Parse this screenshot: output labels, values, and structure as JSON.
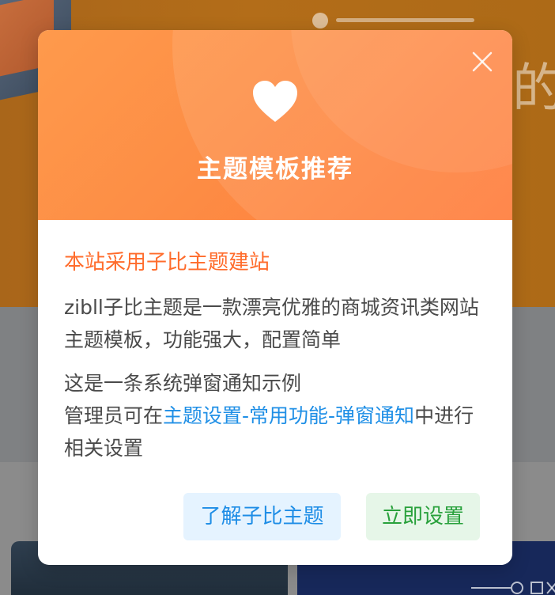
{
  "background": {
    "hero_char": "的"
  },
  "modal": {
    "icon": "heart-icon",
    "close_icon": "close-icon",
    "title": "主题模板推荐",
    "subtitle": "本站采用子比主题建站",
    "description": "zibll子比主题是一款漂亮优雅的商城资讯类网站主题模板，功能强大，配置简单",
    "notice_line1": "这是一条系统弹窗通知示例",
    "notice_prefix": "管理员可在",
    "notice_link": "主题设置-常用功能-弹窗通知",
    "notice_suffix": "中进行相关设置",
    "buttons": {
      "learn": "了解子比主题",
      "settings": "立即设置"
    },
    "colors": {
      "header_gradient_start": "#fe9a4c",
      "header_gradient_end": "#ff7a38",
      "subtitle": "#ff6c2c",
      "link": "#1f8fe6",
      "learn_button_bg": "#e5f3ff",
      "settings_button_bg": "#e6f6e8",
      "settings_button_text": "#29a13c"
    }
  }
}
